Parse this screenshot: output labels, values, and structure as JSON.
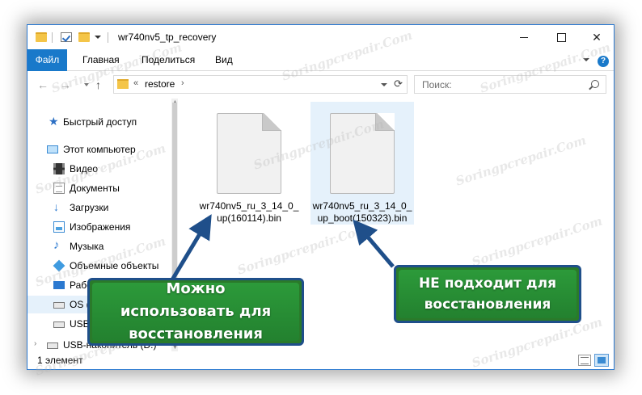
{
  "window": {
    "title": "wr740nv5_tp_recovery"
  },
  "titlebar_controls": {
    "minimize_icon": "minimize-icon",
    "maximize_icon": "maximize-icon",
    "close_glyph": "✕"
  },
  "ribbon": {
    "tabs": [
      "Файл",
      "Главная",
      "Поделиться",
      "Вид"
    ],
    "help_glyph": "?"
  },
  "navigation": {
    "back_glyph": "←",
    "forward_glyph": "→",
    "up_glyph": "↑",
    "address_prefix": "«",
    "address_crumb": "restore",
    "address_chevron": "›",
    "refresh_glyph": "⟳",
    "search_placeholder": "Поиск:"
  },
  "sidebar": {
    "items": [
      {
        "label": "Быстрый доступ",
        "icon": "star-icon"
      },
      {
        "label": "Этот компьютер",
        "icon": "computer-icon"
      },
      {
        "label": "Видео",
        "icon": "video-icon"
      },
      {
        "label": "Документы",
        "icon": "documents-icon"
      },
      {
        "label": "Загрузки",
        "icon": "downloads-icon"
      },
      {
        "label": "Изображения",
        "icon": "pictures-icon"
      },
      {
        "label": "Музыка",
        "icon": "music-icon"
      },
      {
        "label": "Объемные объекты",
        "icon": "3d-objects-icon"
      },
      {
        "label": "Рабочий стол",
        "icon": "desktop-icon"
      },
      {
        "label": "OS (C:)",
        "icon": "drive-icon"
      },
      {
        "label": "USB-накопитель (D:)",
        "icon": "usb-drive-icon"
      },
      {
        "label": "USB-накопитель (D:)",
        "icon": "usb-drive-icon"
      }
    ]
  },
  "files": [
    {
      "name": "wr740nv5_ru_3_14_0_up(160114).bin",
      "icon": "file-icon"
    },
    {
      "name": "wr740nv5_ru_3_14_0_up_boot(150323).bin",
      "icon": "file-icon"
    }
  ],
  "status": {
    "item_count": "1 элемент"
  },
  "callouts": {
    "left": [
      "Можно",
      "использовать для",
      "восстановления"
    ],
    "right": [
      "НЕ подходит для",
      "восстановления"
    ]
  },
  "colors": {
    "accent": "#1979ca",
    "callout_green": "#2c9a3a",
    "callout_border": "#1f4f8a",
    "arrow": "#1f4f8a"
  },
  "watermark": "Soringpcrepair.Com"
}
